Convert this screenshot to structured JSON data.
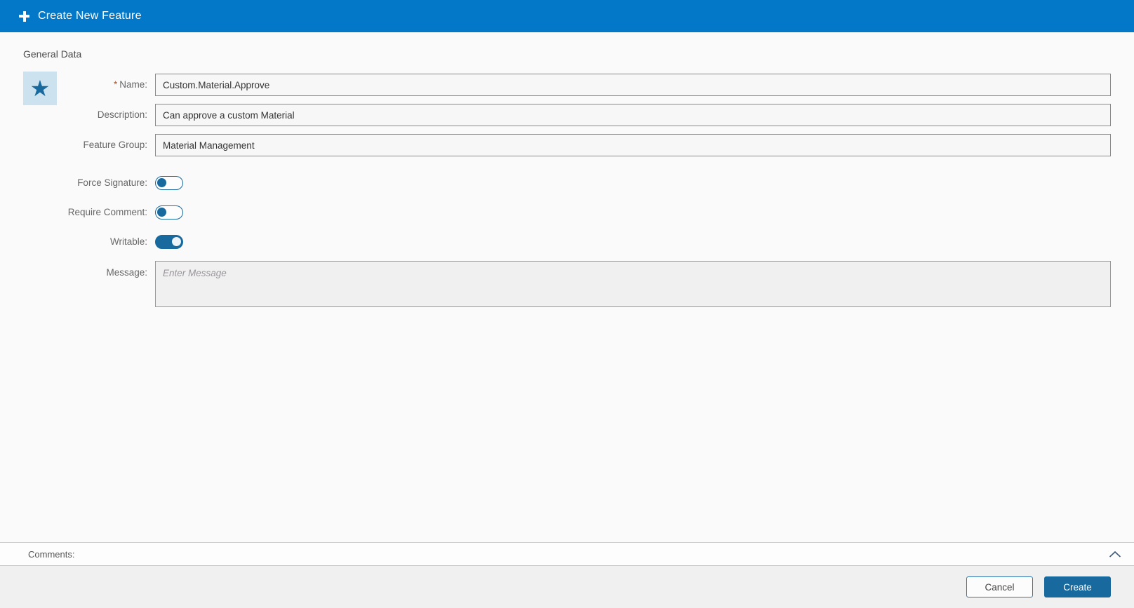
{
  "header": {
    "title": "Create New Feature",
    "icon": "plus"
  },
  "section_title": "General Data",
  "feature_icon": {
    "glyph": "★",
    "name": "star"
  },
  "form": {
    "name": {
      "label": "Name:",
      "required_marker": "*",
      "value": "Custom.Material.Approve"
    },
    "description": {
      "label": "Description:",
      "value": "Can approve a custom Material"
    },
    "feature_group": {
      "label": "Feature Group:",
      "value": "Material Management"
    },
    "force_signature": {
      "label": "Force Signature:",
      "state": "off"
    },
    "require_comment": {
      "label": "Require Comment:",
      "state": "off"
    },
    "writable": {
      "label": "Writable:",
      "state": "on"
    },
    "message": {
      "label": "Message:",
      "value": "",
      "placeholder": "Enter Message"
    }
  },
  "comments": {
    "label": "Comments:",
    "collapse_icon": "chevron-up"
  },
  "footer": {
    "cancel_label": "Cancel",
    "create_label": "Create"
  },
  "colors": {
    "header_bg": "#0478c8",
    "accent_blue": "#17699e",
    "star_box_bg": "#cde2ef",
    "content_bg": "#fafafa",
    "footer_bg": "#f0f0f0",
    "required_marker": "#b15a2a"
  }
}
